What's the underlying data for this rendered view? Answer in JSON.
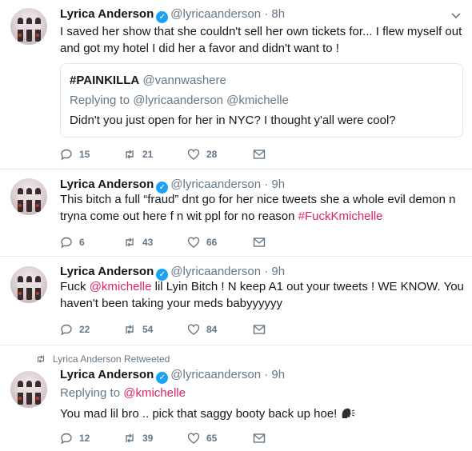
{
  "author": {
    "name": "Lyrica Anderson",
    "handle": "@lyricaanderson",
    "separator": "·"
  },
  "tweets": [
    {
      "time": "8h",
      "text": "I saved her show that she couldn't sell her own tickets for... I flew myself out and got my hotel I did her a favor and didn't want to !",
      "quote": {
        "name": "#PAINKILLA",
        "handle": "@vannwashere",
        "replying_prefix": "Replying to",
        "replying_to": "@lyricaanderson @kmichelle",
        "text": "Didn't you just open for her in NYC? I thought y'all were cool?"
      },
      "replies": "15",
      "retweets": "21",
      "likes": "28"
    },
    {
      "time": "9h",
      "text": "This bitch a full “fraud” dnt go for her nice tweets she a whole evil demon n tryna come out here f n wit ppl for no reason ",
      "hashtag": "#FuckKmichelle",
      "replies": "6",
      "retweets": "43",
      "likes": "66"
    },
    {
      "time": "9h",
      "text_pre": "Fuck ",
      "mention": "@kmichelle",
      "text_post": " lil Lyin Bitch ! N keep A1 out your tweets ! WE KNOW. You haven't been taking your meds babyyyyyy",
      "replies": "22",
      "retweets": "54",
      "likes": "84"
    },
    {
      "time": "9h",
      "retweet_note": "Lyrica Anderson Retweeted",
      "replying_prefix": "Replying to",
      "replying_to": "@kmichelle",
      "text": "You mad lil bro .. pick that saggy booty back up hoe!",
      "emoji": "speaking-head-emoji",
      "replies": "12",
      "retweets": "39",
      "likes": "65"
    }
  ],
  "colors": {
    "verified": "#1da1f2",
    "link": "#e0245e",
    "meta": "#657786",
    "divider": "#e6ecf0"
  }
}
